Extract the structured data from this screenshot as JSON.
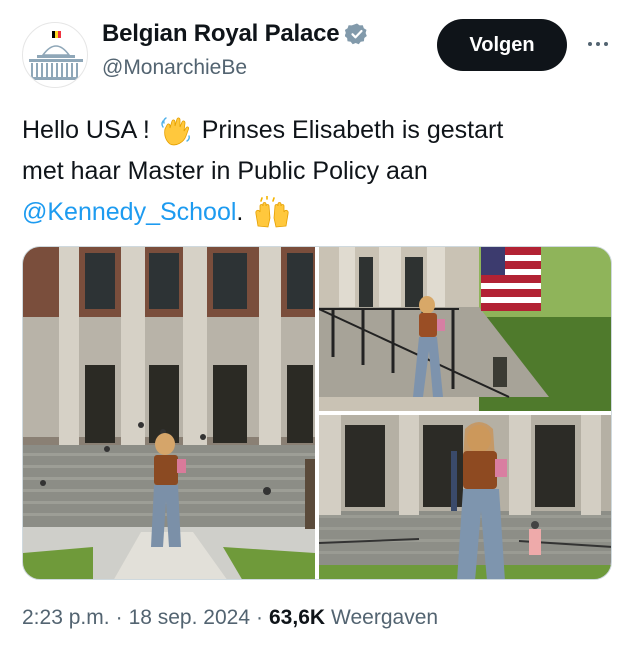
{
  "author": {
    "display_name": "Belgian Royal Palace",
    "handle": "@MonarchieBe",
    "verified_icon": "verified-gray-badge-icon",
    "avatar_icon": "royal-palace-building-icon",
    "flag_colors": [
      "#000000",
      "#FDDA24",
      "#EF3340"
    ]
  },
  "actions": {
    "follow_label": "Volgen",
    "more_icon": "more-horizontal-icon"
  },
  "tweet": {
    "line1_prefix": "Hello USA !",
    "line1_emoji": "waving-hand-emoji",
    "line1_suffix": "Prinses Elisabeth is gestart",
    "line2": "met haar Master in Public Policy aan",
    "mention": "@Kennedy_School",
    "line3_suffix": ".",
    "line3_emoji": "raising-hands-emoji"
  },
  "media": {
    "photos": [
      {
        "name": "photo-princess-walking-building"
      },
      {
        "name": "photo-princess-on-steps-flag"
      },
      {
        "name": "photo-princess-closeup-walking"
      }
    ]
  },
  "meta": {
    "time": "2:23 p.m.",
    "separator": "·",
    "date": "18 sep. 2024",
    "views_count": "63,6K",
    "views_label": "Weergaven"
  },
  "colors": {
    "accent": "#1d9bf0",
    "text": "#0f1419",
    "secondary": "#536471",
    "button_bg": "#0f1419"
  }
}
